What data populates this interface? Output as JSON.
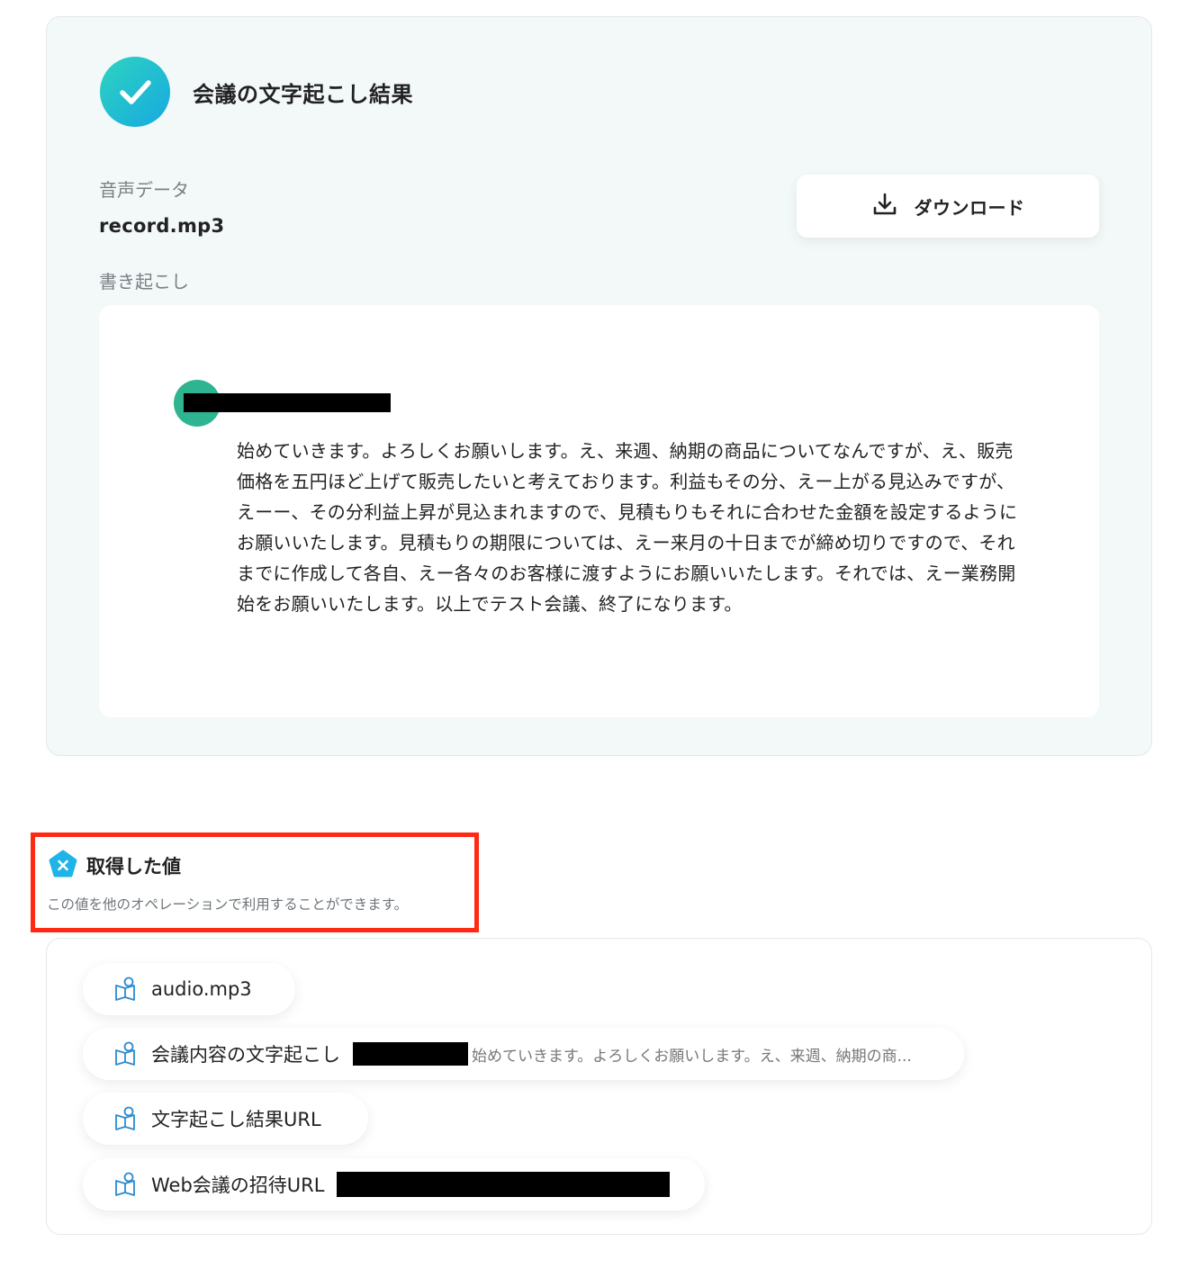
{
  "result": {
    "title": "会議の文字起こし結果",
    "audio_label": "音声データ",
    "audio_file": "record.mp3",
    "transcript_label": "書き起こし",
    "download_label": "ダウンロード",
    "transcript_text": "始めていきます。よろしくお願いします。え、来週、納期の商品についてなんですが、え、販売価格を五円ほど上げて販売したいと考えております。利益もその分、えー上がる見込みですが、えーー、その分利益上昇が見込まれますので、見積もりもそれに合わせた金額を設定するようにお願いいたします。見積もりの期限については、えー来月の十日までが締め切りですので、それまでに作成して各自、えー各々のお客様に渡すようにお願いいたします。それでは、えー業務開始をお願いいたします。以上でテスト会議、終了になります。"
  },
  "acquired": {
    "title": "取得した値",
    "description": "この値を他のオペレーションで利用することができます。",
    "items": [
      {
        "label": "audio.mp3"
      },
      {
        "label": "会議内容の文字起こし",
        "preview": "始めていきます。よろしくお願いします。え、来週、納期の商..."
      },
      {
        "label": "文字起こし結果URL"
      },
      {
        "label": "Web会議の招待URL"
      }
    ]
  },
  "colors": {
    "accent_gradient_start": "#2dd4c0",
    "accent_gradient_end": "#17a9e0",
    "avatar": "#2fb491",
    "highlight_border": "#ff2a14",
    "card_bg": "#f3f9f9"
  },
  "icons": [
    "check-icon",
    "download-icon",
    "x-pentagon-icon",
    "variable-icon"
  ]
}
